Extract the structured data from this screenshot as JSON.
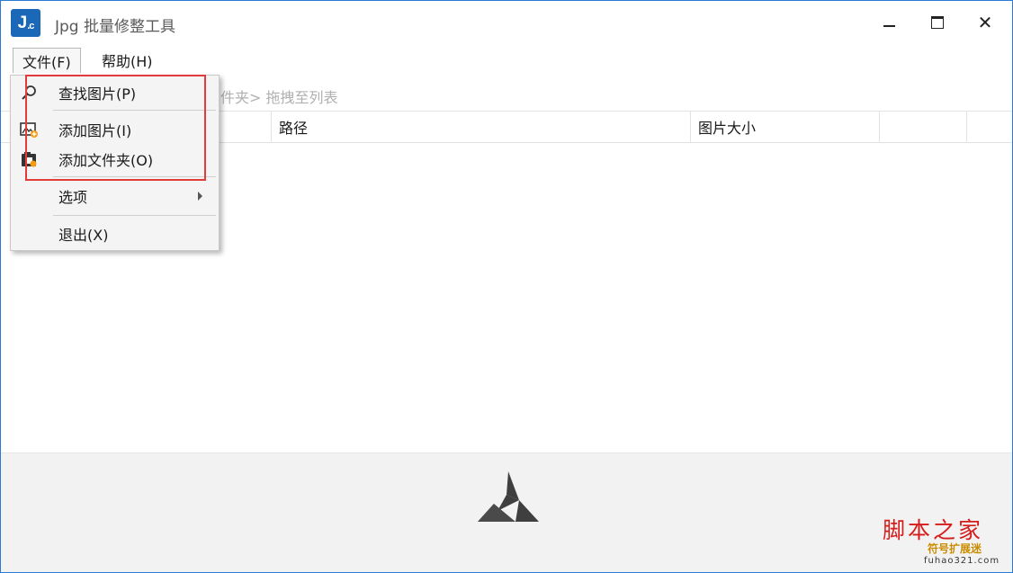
{
  "window": {
    "title": "Jpg 批量修整工具",
    "logo_text": "J",
    "logo_sub": ".c",
    "close_glyph": "✕"
  },
  "menubar": {
    "file": "文件(F)",
    "help": "帮助(H)"
  },
  "hint": "件夹> 拖拽至列表",
  "table": {
    "columns": [
      "路径",
      "图片大小",
      "",
      ""
    ]
  },
  "file_menu": {
    "items": [
      {
        "label": "查找图片(P)",
        "icon": "search-icon"
      },
      {
        "label": "添加图片(I)",
        "icon": "add-image-icon"
      },
      {
        "label": "添加文件夹(O)",
        "icon": "add-folder-icon"
      },
      {
        "label": "选项",
        "icon": "",
        "submenu": true
      },
      {
        "label": "退出(X)",
        "icon": ""
      }
    ]
  },
  "watermark": {
    "main": "脚本之家",
    "sub": "符号扩展迷",
    "url": "fuhao321.com"
  },
  "colors": {
    "accent": "#1b67b8",
    "highlight_box": "#e13b3b",
    "watermark_red": "#d61b1b"
  }
}
